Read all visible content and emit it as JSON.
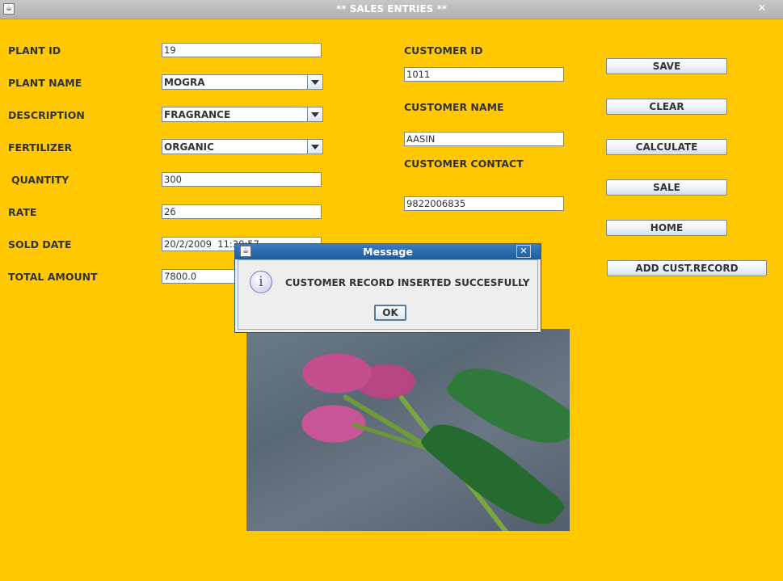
{
  "window": {
    "title": "** SALES ENTRIES **",
    "icon": "java-app-icon",
    "close_glyph": "✕"
  },
  "form": {
    "plant_id": {
      "label": "PLANT ID",
      "value": "19"
    },
    "plant_name": {
      "label": "PLANT NAME",
      "value": "MOGRA"
    },
    "description": {
      "label": "DESCRIPTION",
      "value": "FRAGRANCE"
    },
    "fertilizer": {
      "label": "FERTILIZER",
      "value": "ORGANIC"
    },
    "quantity": {
      "label": "QUANTITY",
      "value": "300"
    },
    "rate": {
      "label": "RATE",
      "value": "26"
    },
    "sold_date": {
      "label": "SOLD DATE",
      "value": "20/2/2009  11:30:57"
    },
    "total_amount": {
      "label": "TOTAL AMOUNT",
      "value": "7800.0"
    },
    "customer_id": {
      "label": "CUSTOMER ID",
      "value": "1011"
    },
    "customer_name": {
      "label": "CUSTOMER NAME",
      "value": "AASIN"
    },
    "customer_contact": {
      "label": "CUSTOMER CONTACT",
      "value": "9822006835"
    }
  },
  "buttons": {
    "save": "SAVE",
    "clear": "CLEAR",
    "calculate": "CALCULATE",
    "sale": "SALE",
    "home": "HOME",
    "add_cust_record": "ADD CUST.RECORD"
  },
  "dialog": {
    "title": "Message",
    "icon": "info-icon",
    "icon_glyph": "i",
    "message": "CUSTOMER RECORD INSERTED SUCCESFULLY",
    "ok_label": "OK",
    "close_glyph": "✕"
  },
  "colors": {
    "background": "#ffc800",
    "dialog_title": "#1f5c9c"
  }
}
